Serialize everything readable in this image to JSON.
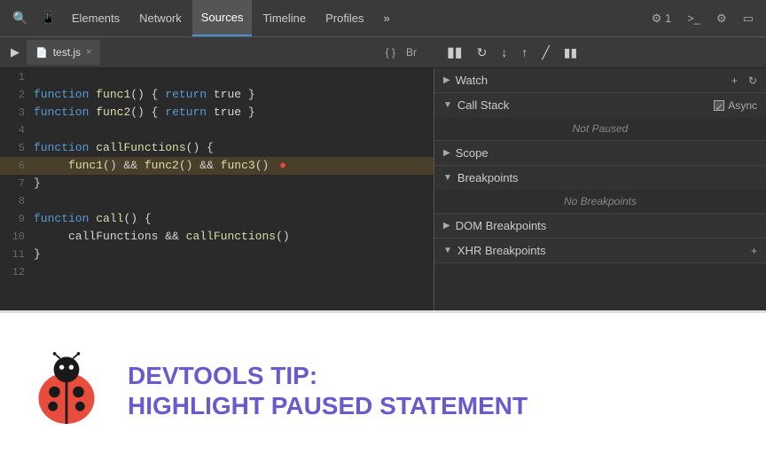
{
  "toolbar": {
    "nav_items": [
      {
        "label": "Elements",
        "active": false
      },
      {
        "label": "Network",
        "active": false
      },
      {
        "label": "Sources",
        "active": true
      },
      {
        "label": "Timeline",
        "active": false
      },
      {
        "label": "Profiles",
        "active": false
      }
    ],
    "right_items": [
      {
        "label": "⚙1"
      },
      {
        "label": ">_"
      },
      {
        "label": "⚙"
      },
      {
        "label": "▭"
      }
    ],
    "more_label": "»"
  },
  "debug_toolbar": {
    "tab_name": "test.js",
    "close_label": "×",
    "buttons": [
      "▶",
      "⏸",
      "↺",
      "↓",
      "↑",
      "↕",
      "⏸"
    ]
  },
  "code": {
    "lines": [
      {
        "num": "1",
        "content": ""
      },
      {
        "num": "2",
        "content": "function func1() { return true }"
      },
      {
        "num": "3",
        "content": "function func2() { return true }"
      },
      {
        "num": "4",
        "content": ""
      },
      {
        "num": "5",
        "content": "function callFunctions() {"
      },
      {
        "num": "6",
        "content": "     func1() && func2() && func3()",
        "highlighted": true,
        "error": true
      },
      {
        "num": "7",
        "content": "}"
      },
      {
        "num": "8",
        "content": ""
      },
      {
        "num": "9",
        "content": "function call() {"
      },
      {
        "num": "10",
        "content": "     callFunctions && callFunctions()"
      },
      {
        "num": "11",
        "content": "}"
      },
      {
        "num": "12",
        "content": ""
      }
    ]
  },
  "right_panel": {
    "sections": [
      {
        "title": "Watch",
        "expanded": false,
        "arrow": "▶",
        "actions": [
          "+",
          "↺"
        ],
        "content": null
      },
      {
        "title": "Call Stack",
        "expanded": true,
        "arrow": "▼",
        "async_label": "Async",
        "content": "Not Paused"
      },
      {
        "title": "Scope",
        "expanded": false,
        "arrow": "▶",
        "content": null
      },
      {
        "title": "Breakpoints",
        "expanded": true,
        "arrow": "▼",
        "content": "No Breakpoints"
      },
      {
        "title": "DOM Breakpoints",
        "expanded": false,
        "arrow": "▶",
        "content": null
      },
      {
        "title": "XHR Breakpoints",
        "expanded": false,
        "arrow": "▼",
        "content": null
      }
    ]
  },
  "tip": {
    "title": "DevTools Tip:",
    "subtitle": "Highlight Paused Statement"
  }
}
